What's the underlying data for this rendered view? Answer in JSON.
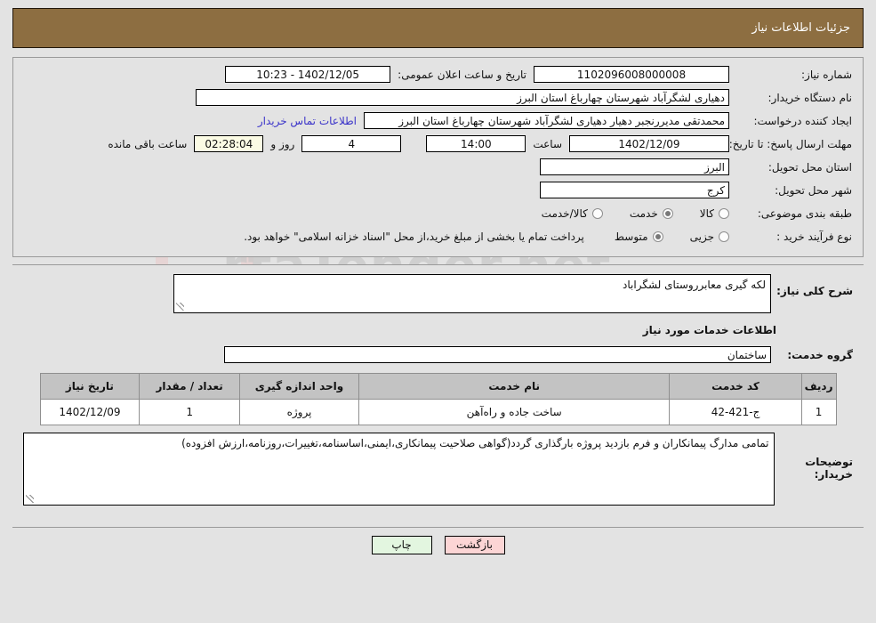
{
  "header": {
    "title": "جزئیات اطلاعات نیاز"
  },
  "colors": {
    "header_bar": "#8d6e41",
    "table_header": "#c3c3c3",
    "link": "#3b34c9",
    "countdown_field": "#fbfbe4",
    "back_button": "#fcd5d5",
    "print_button": "#e3f6e0",
    "page_background": "#e3e3e3"
  },
  "top_form": {
    "need_number_label": "شماره نیاز:",
    "need_number_value": "1102096008000008",
    "announce_datetime_label": "تاریخ و ساعت اعلان عمومی:",
    "announce_datetime_value": "1402/12/05 - 10:23",
    "buyer_org_label": "نام دستگاه خریدار:",
    "buyer_org_value": "دهیاری لشگرآباد شهرستان چهارباغ استان البرز",
    "requester_label": "ایجاد کننده درخواست:",
    "requester_value": "محمدتقی مدیررنجبر دهیار دهیاری لشگرآباد شهرستان چهارباغ استان البرز",
    "contact_link": "اطلاعات تماس خریدار",
    "deadline_label": "مهلت ارسال پاسخ: تا تاریخ:",
    "deadline_date": "1402/12/09",
    "hour_label": "ساعت",
    "deadline_time": "14:00",
    "days_value": "4",
    "days_label": "روز و",
    "remaining_value": "02:28:04",
    "remaining_label": "ساعت باقی مانده",
    "province_label": "استان محل تحویل:",
    "province_value": "البرز",
    "city_label": "شهر محل تحویل:",
    "city_value": "کرج",
    "category_label": "طبقه بندی موضوعی:",
    "category_options": [
      {
        "label": "کالا",
        "selected": false
      },
      {
        "label": "خدمت",
        "selected": true
      },
      {
        "label": "کالا/خدمت",
        "selected": false
      }
    ],
    "process_label": "نوع فرآیند خرید :",
    "process_options": [
      {
        "label": "جزیی",
        "selected": false
      },
      {
        "label": "متوسط",
        "selected": true
      }
    ],
    "payment_note": "پرداخت تمام یا بخشی از مبلغ خرید،از محل \"اسناد خزانه اسلامی\" خواهد بود."
  },
  "description": {
    "label": "شرح کلی نیاز:",
    "value": "لکه گیری معابرروستای لشگراباد"
  },
  "services_section": {
    "heading": "اطلاعات خدمات مورد نیاز",
    "group_label": "گروه خدمت:",
    "group_value": "ساختمان"
  },
  "items_table": {
    "columns": [
      "ردیف",
      "کد خدمت",
      "نام خدمت",
      "واحد اندازه گیری",
      "تعداد / مقدار",
      "تاریخ نیاز"
    ],
    "rows": [
      {
        "radif": "1",
        "code": "ج-421-42",
        "name": "ساخت جاده و راه‌آهن",
        "unit": "پروژه",
        "qty": "1",
        "date": "1402/12/09"
      }
    ]
  },
  "buyer_comments": {
    "label": "توضیحات خریدار:",
    "value": "تمامی مدارگ پیمانکاران و فرم بازدید پروژه بارگذاری گردد(گواهی صلاحیت پیمانکاری،ایمنی،اساسنامه،تغییرات،روزنامه،ارزش افزوده)"
  },
  "footer": {
    "back_label": "بازگشت",
    "print_label": "چاپ"
  }
}
